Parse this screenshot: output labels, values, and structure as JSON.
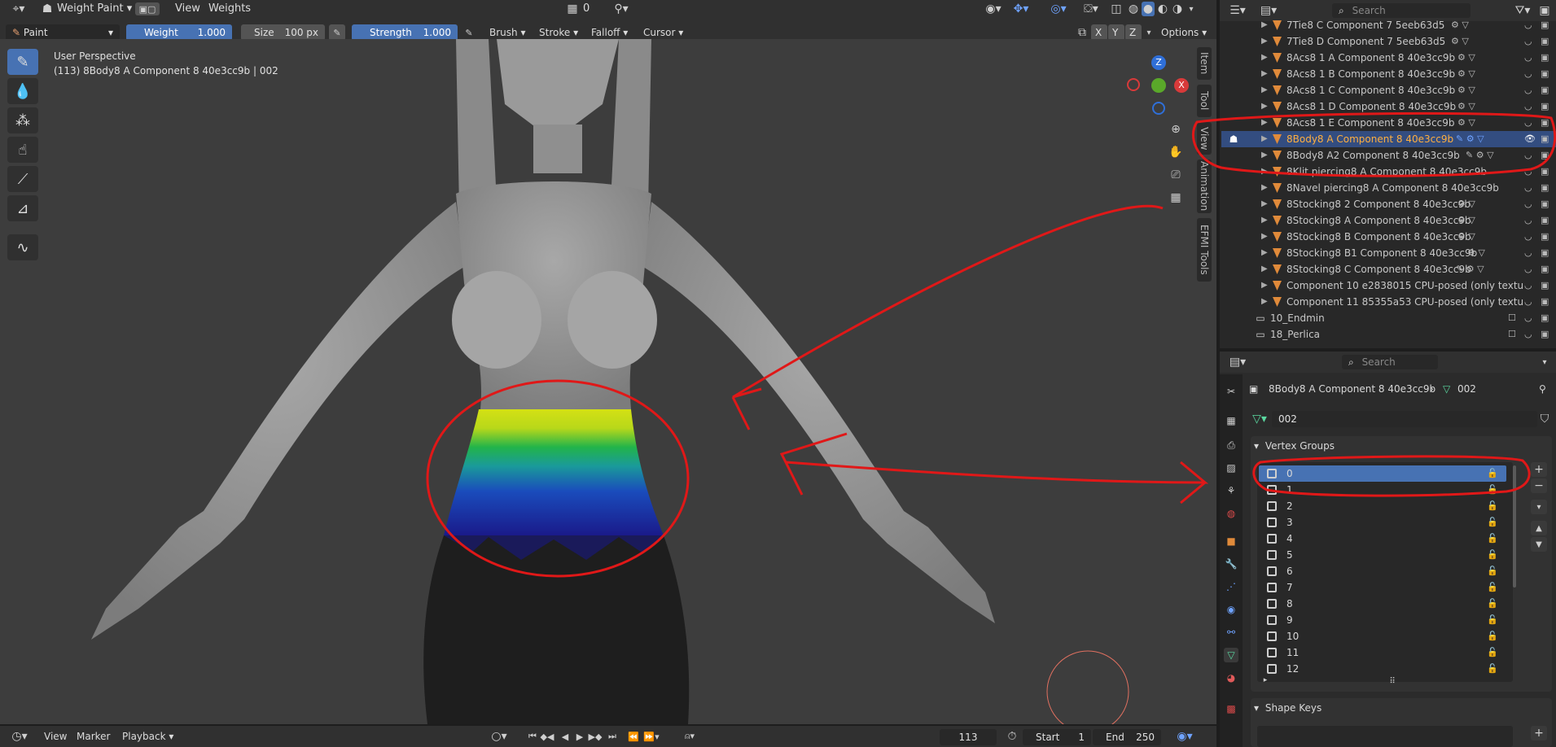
{
  "header": {
    "mode": "Weight Paint",
    "menus": [
      "View",
      "Weights"
    ],
    "frame_value": "0",
    "search_placeholder": "Search"
  },
  "toolbar": {
    "brush_name": "Paint",
    "weight_label": "Weight",
    "weight_value": "1.000",
    "size_label": "Size",
    "size_value": "100 px",
    "strength_label": "Strength",
    "strength_value": "1.000",
    "menus": [
      "Brush",
      "Stroke",
      "Falloff",
      "Cursor"
    ],
    "axes": [
      "X",
      "Y",
      "Z"
    ],
    "options": "Options"
  },
  "viewport": {
    "perspective": "User Perspective",
    "object_info": "(113) 8Body8 A Component 8 40e3cc9b | 002",
    "sidebar_tabs": [
      "Item",
      "Tool",
      "View",
      "Animation",
      "EFMI Tools"
    ],
    "gizmo": {
      "z": "Z",
      "x": "X"
    }
  },
  "outliner": {
    "search_placeholder": "Search",
    "rows": [
      {
        "label": "7Tie8 C Component 7 5eeb63d5",
        "selected": false
      },
      {
        "label": "7Tie8 D Component 7 5eeb63d5",
        "selected": false
      },
      {
        "label": "8Acs8 1 A Component 8 40e3cc9b",
        "selected": false
      },
      {
        "label": "8Acs8 1 B Component 8 40e3cc9b",
        "selected": false
      },
      {
        "label": "8Acs8 1 C Component 8 40e3cc9b",
        "selected": false
      },
      {
        "label": "8Acs8 1 D Component 8 40e3cc9b",
        "selected": false
      },
      {
        "label": "8Acs8 1 E Component 8 40e3cc9b",
        "selected": false
      },
      {
        "label": "8Body8 A Component 8 40e3cc9b",
        "selected": true
      },
      {
        "label": "8Body8 A2 Component 8 40e3cc9b",
        "selected": false
      },
      {
        "label": "8Klit piercing8 A Component 8 40e3cc9b",
        "selected": false
      },
      {
        "label": "8Navel piercing8 A Component 8 40e3cc9b",
        "selected": false
      },
      {
        "label": "8Stocking8 2 Component 8 40e3cc9b",
        "selected": false
      },
      {
        "label": "8Stocking8 A Component 8 40e3cc9b",
        "selected": false
      },
      {
        "label": "8Stocking8 B Component 8 40e3cc9b",
        "selected": false
      },
      {
        "label": "8Stocking8 B1 Component 8 40e3cc9b",
        "selected": false
      },
      {
        "label": "8Stocking8 C Component 8 40e3cc9b",
        "selected": false
      },
      {
        "label": "Component 10 e2838015 CPU-posed (only textu",
        "selected": false
      },
      {
        "label": "Component 11 85355a53 CPU-posed (only textu",
        "selected": false
      }
    ],
    "collections": [
      "10_Endmin",
      "18_Perlica"
    ]
  },
  "properties": {
    "search_placeholder": "Search",
    "object_name": "8Body8 A Component 8 40e3cc9b",
    "mesh_name": "002",
    "mesh_field": "002",
    "vertex_groups_title": "Vertex Groups",
    "vertex_groups": [
      "0",
      "1",
      "2",
      "3",
      "4",
      "5",
      "6",
      "7",
      "8",
      "9",
      "10",
      "11",
      "12"
    ],
    "shape_keys_title": "Shape Keys"
  },
  "timeline": {
    "menus": [
      "View",
      "Marker",
      "Playback"
    ],
    "current_frame": "113",
    "start_label": "Start",
    "start_value": "1",
    "end_label": "End",
    "end_value": "250"
  },
  "colors": {
    "accent": "#4772b3",
    "annotation": "#e01818",
    "object_orange": "#e08a3a"
  }
}
